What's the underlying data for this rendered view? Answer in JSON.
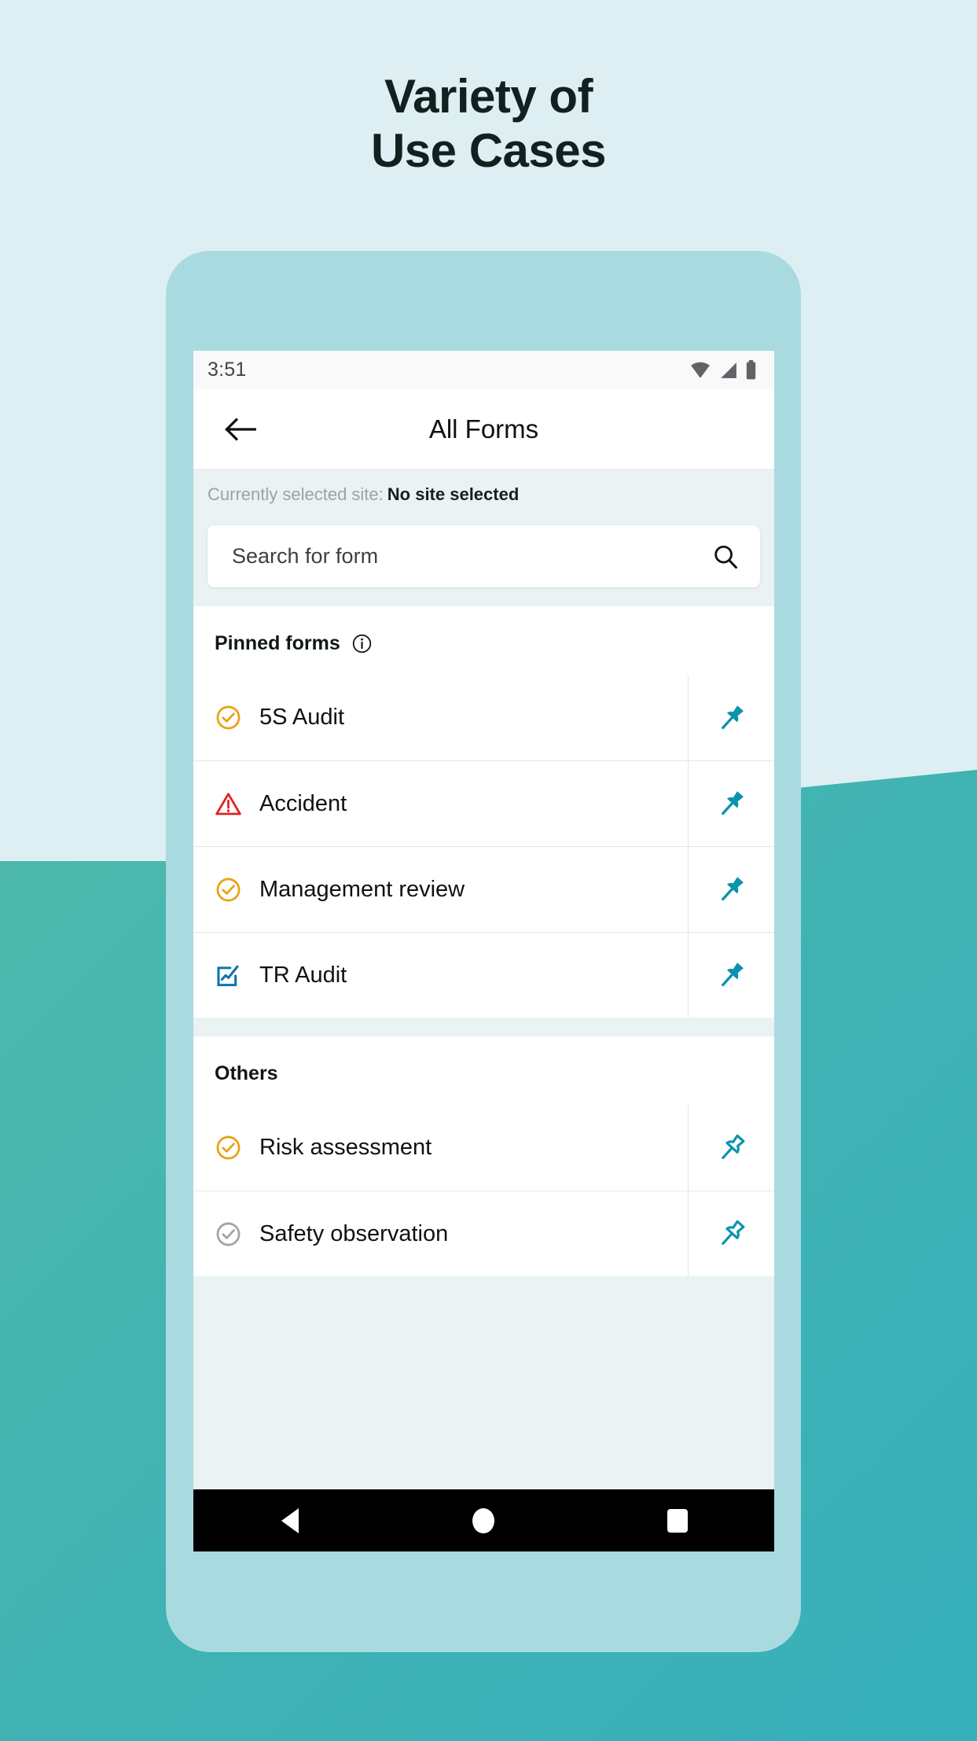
{
  "headline": {
    "line1": "Variety of",
    "line2": "Use Cases"
  },
  "colors": {
    "page_background": "#ddeff2",
    "wave_teal": "#3fb5b0",
    "phone_frame": "#a9dadf",
    "screen_background": "#eaf2f3",
    "accent_pin": "#0b93ad",
    "amber_icon": "#e8a317",
    "red_icon": "#e02020",
    "blue_icon": "#1073ad",
    "grey_icon": "#a0a5a6"
  },
  "status_bar": {
    "time": "3:51",
    "icons": [
      "wifi-icon",
      "cellular-signal-icon",
      "battery-icon"
    ]
  },
  "app_bar": {
    "back_icon": "arrow-left-icon",
    "title": "All Forms"
  },
  "site_strip": {
    "label": "Currently selected site:",
    "value": "No site selected"
  },
  "search": {
    "placeholder": "Search for form",
    "value": "",
    "icon": "search-icon"
  },
  "sections": [
    {
      "title": "Pinned forms",
      "info_icon": "info-circle-icon",
      "has_info": true,
      "rows": [
        {
          "label": "5S Audit",
          "icon": "check-circle-icon",
          "icon_color": "#e8a317",
          "pin": "pin-filled-icon",
          "pinned": true
        },
        {
          "label": "Accident",
          "icon": "warning-triangle-icon",
          "icon_color": "#e02020",
          "pin": "pin-filled-icon",
          "pinned": true
        },
        {
          "label": "Management review",
          "icon": "check-circle-icon",
          "icon_color": "#e8a317",
          "pin": "pin-filled-icon",
          "pinned": true
        },
        {
          "label": "TR Audit",
          "icon": "chart-square-icon",
          "icon_color": "#1073ad",
          "pin": "pin-filled-icon",
          "pinned": true
        }
      ]
    },
    {
      "title": "Others",
      "has_info": false,
      "rows": [
        {
          "label": "Risk assessment",
          "icon": "check-circle-icon",
          "icon_color": "#e8a317",
          "pin": "pin-outline-icon",
          "pinned": false
        },
        {
          "label": "Safety observation",
          "icon": "check-circle-icon",
          "icon_color": "#a0a5a6",
          "pin": "pin-outline-icon",
          "pinned": false
        }
      ]
    }
  ],
  "nav_bar": {
    "back": "nav-back-icon",
    "home": "nav-home-icon",
    "recents": "nav-recents-icon"
  }
}
